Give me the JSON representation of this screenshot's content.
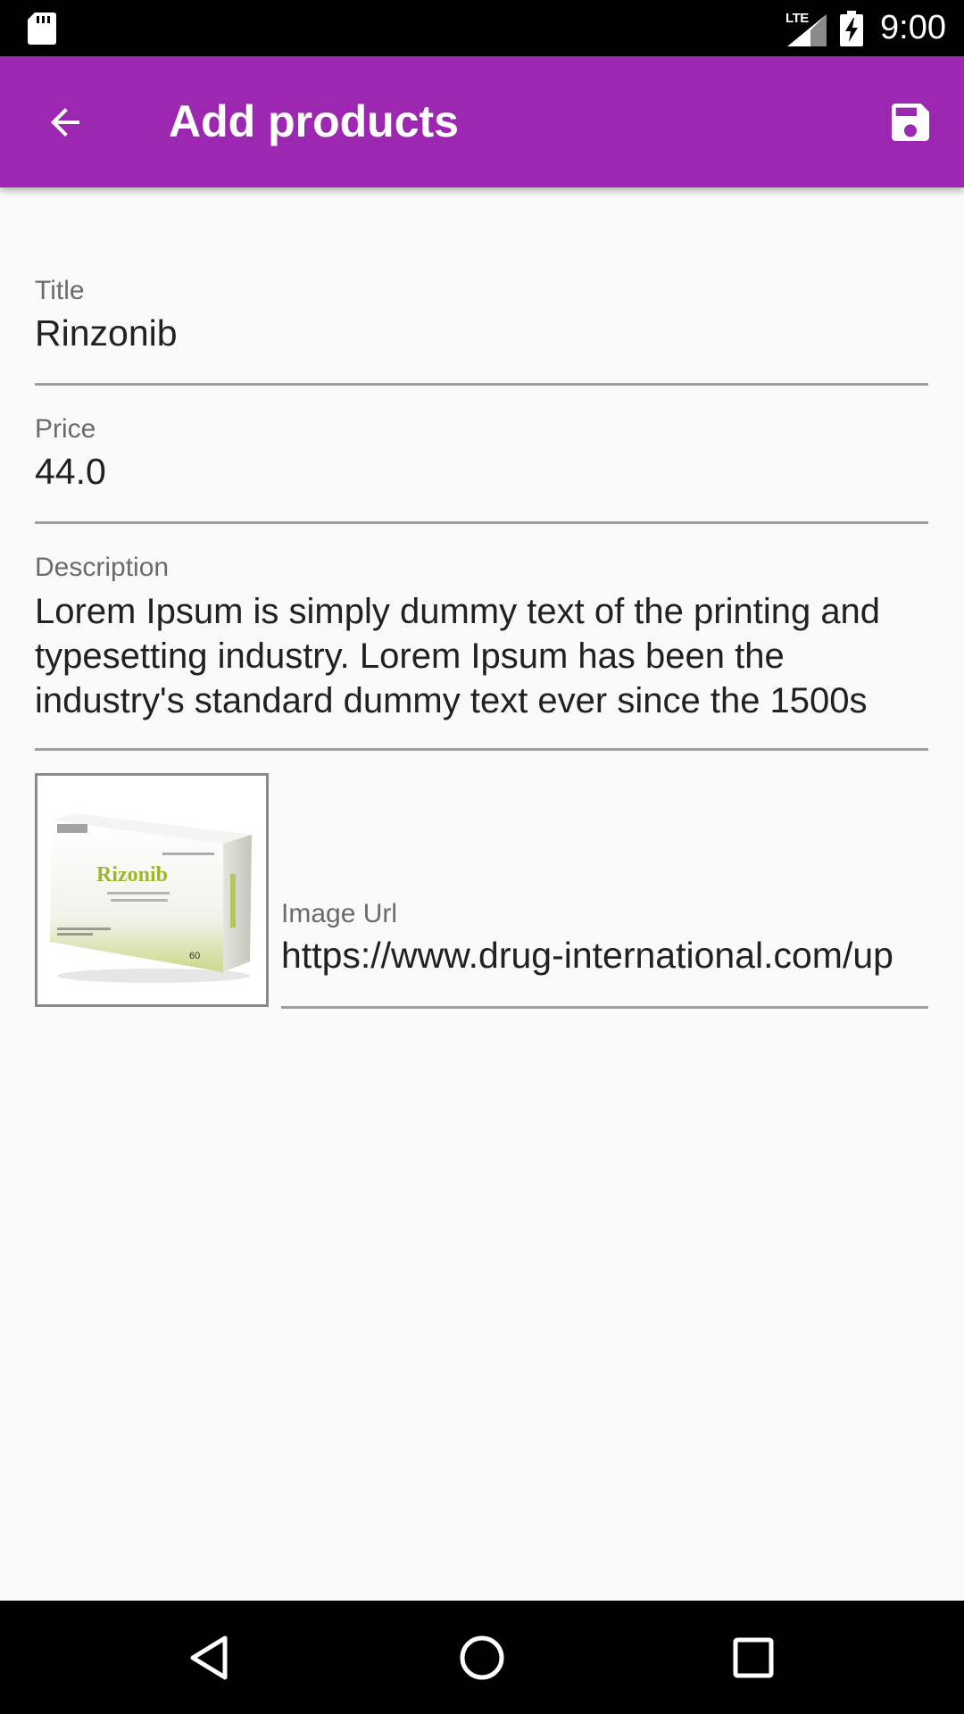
{
  "status_bar": {
    "time": "9:00",
    "network": "LTE",
    "icons": [
      "sd-card-icon",
      "signal-icon",
      "battery-charging-icon"
    ]
  },
  "app_bar": {
    "title": "Add products",
    "back_icon": "arrow-back-icon",
    "save_icon": "save-icon",
    "color": "#9c27b0"
  },
  "form": {
    "title": {
      "label": "Title",
      "value": "Rinzonib"
    },
    "price": {
      "label": "Price",
      "value": "44.0"
    },
    "description": {
      "label": "Description",
      "value": "Lorem Ipsum is simply dummy text of the printing and typesetting industry. Lorem Ipsum has been the industry's standard dummy text ever since the 1500s"
    },
    "image_url": {
      "label": "Image Url",
      "value": "https://www.drug-international.com/up"
    },
    "preview": {
      "brand": "Rizonib",
      "count": "60"
    }
  },
  "nav_bar": {
    "icons": [
      "nav-back-icon",
      "nav-home-icon",
      "nav-recents-icon"
    ]
  }
}
